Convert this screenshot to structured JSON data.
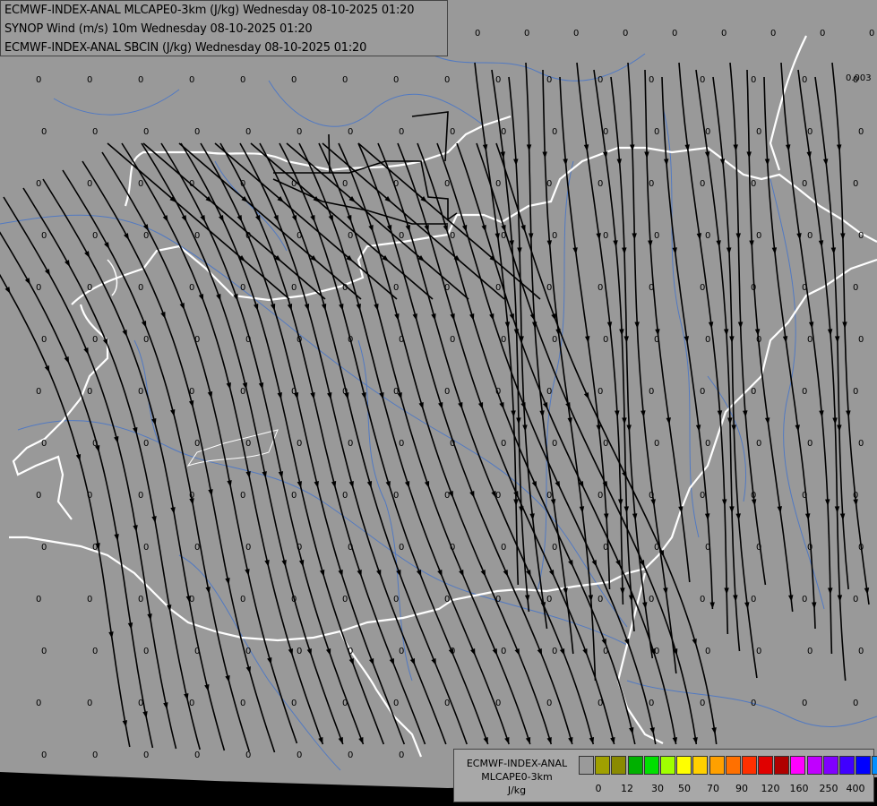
{
  "header": {
    "line1": "ECMWF-INDEX-ANAL MLCAPE0-3km (J/kg) Wednesday 08-10-2025 01:20",
    "line2": "SYNOP Wind (m/s) 10m Wednesday 08-10-2025 01:20",
    "line3": "ECMWF-INDEX-ANAL SBCIN (J/kg) Wednesday 08-10-2025 01:20"
  },
  "legend": {
    "title_line1": "ECMWF-INDEX-ANAL",
    "title_line2": "MLCAPE0-3km",
    "unit": "J/kg",
    "colors": [
      "#9a9a9a",
      "#a0a000",
      "#8a8a00",
      "#00b000",
      "#00e000",
      "#a0ff00",
      "#ffff00",
      "#ffd000",
      "#ffa000",
      "#ff7000",
      "#ff3000",
      "#e00000",
      "#b00000",
      "#ff00ff",
      "#c000ff",
      "#8000ff",
      "#4000ff",
      "#0000ff",
      "#0090ff",
      "#00d0ff",
      "#60ffff",
      "#ffffff"
    ],
    "tick_labels": [
      "0",
      "12",
      "30",
      "50",
      "70",
      "90",
      "120",
      "160",
      "250",
      "400"
    ]
  },
  "map": {
    "sbcin_value_label": "0",
    "corner_label": "0.003",
    "colors": {
      "background": "#999999",
      "border": "#ffffff",
      "river": "#3a6fd0",
      "streamline": "#000000"
    }
  }
}
